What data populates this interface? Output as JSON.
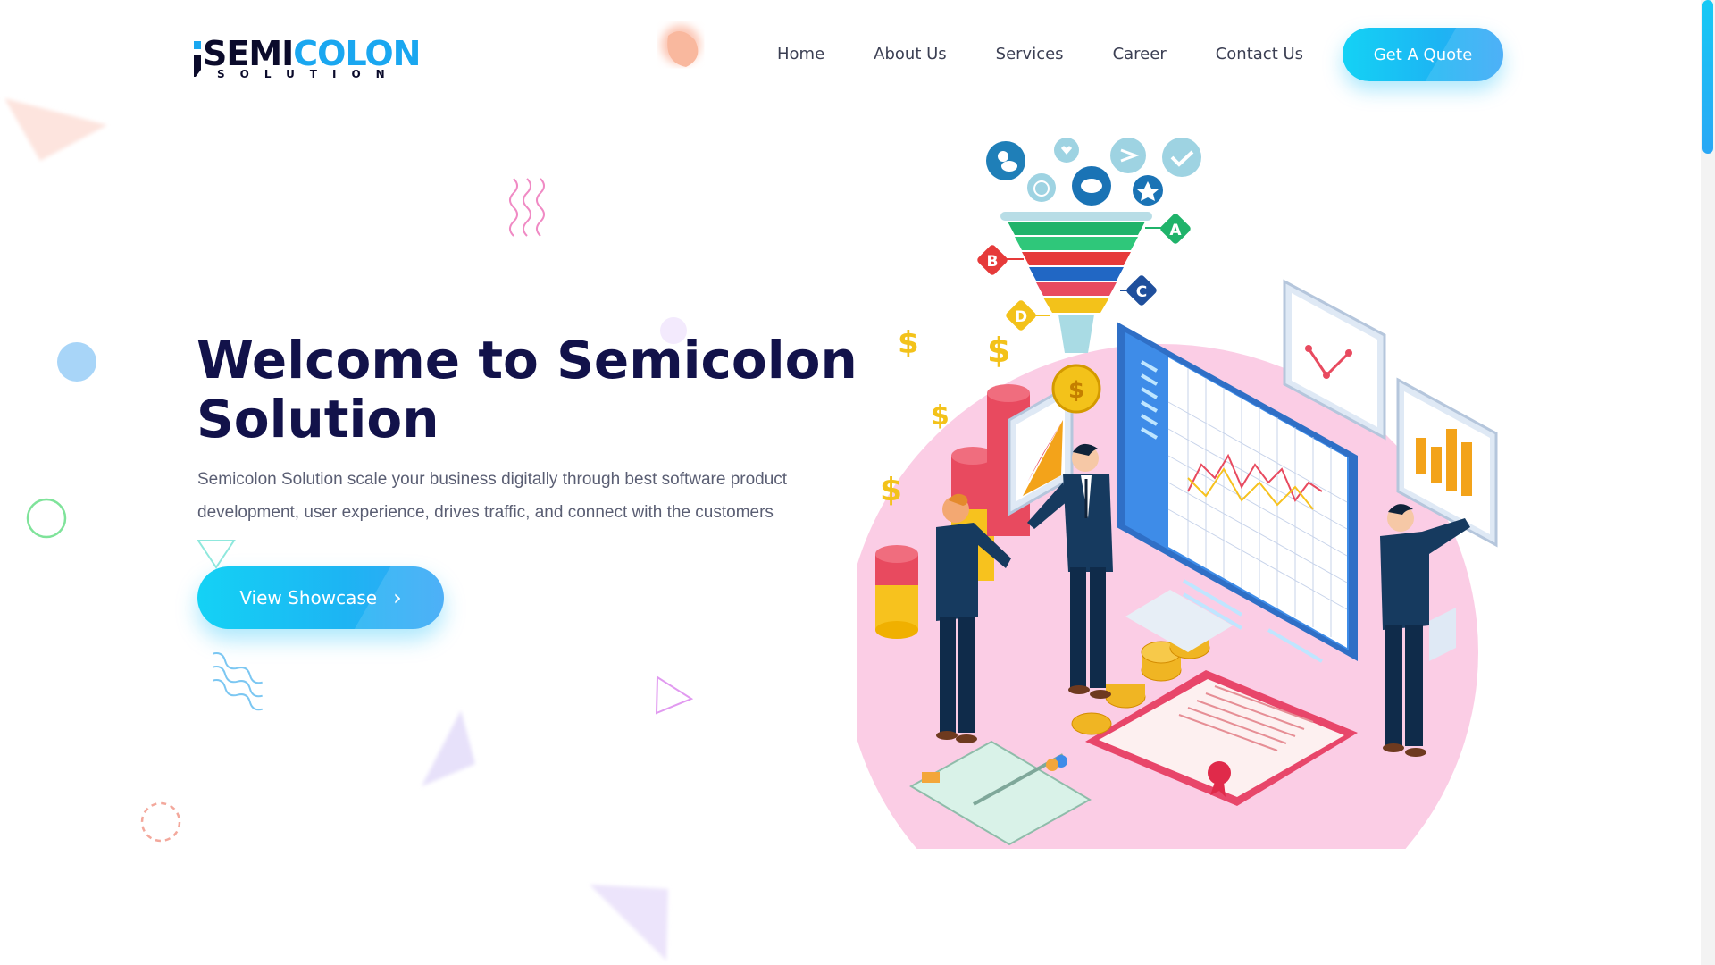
{
  "brand": {
    "logo_main_dark": "SEMI",
    "logo_main_blue": "COLON",
    "logo_sub": "SOLUTION",
    "accent": "#1aa7f0",
    "dark": "#12124a"
  },
  "nav": {
    "items": [
      {
        "label": "Home"
      },
      {
        "label": "About Us"
      },
      {
        "label": "Services"
      },
      {
        "label": "Career"
      },
      {
        "label": "Contact Us"
      }
    ],
    "cta_label": "Get A Quote"
  },
  "hero": {
    "title_line1": "Welcome to Semicolon",
    "title_line2": "Solution",
    "description_line1": "Semicolon Solution scale your business digitally through best software product",
    "description_line2": "development, user experience, drives traffic, and connect with the customers",
    "button_label": "View Showcase",
    "button_icon": "chevron-right-icon"
  },
  "illustration": {
    "funnel_labels": [
      "A",
      "B",
      "C",
      "D"
    ],
    "currency_symbol": "$"
  }
}
